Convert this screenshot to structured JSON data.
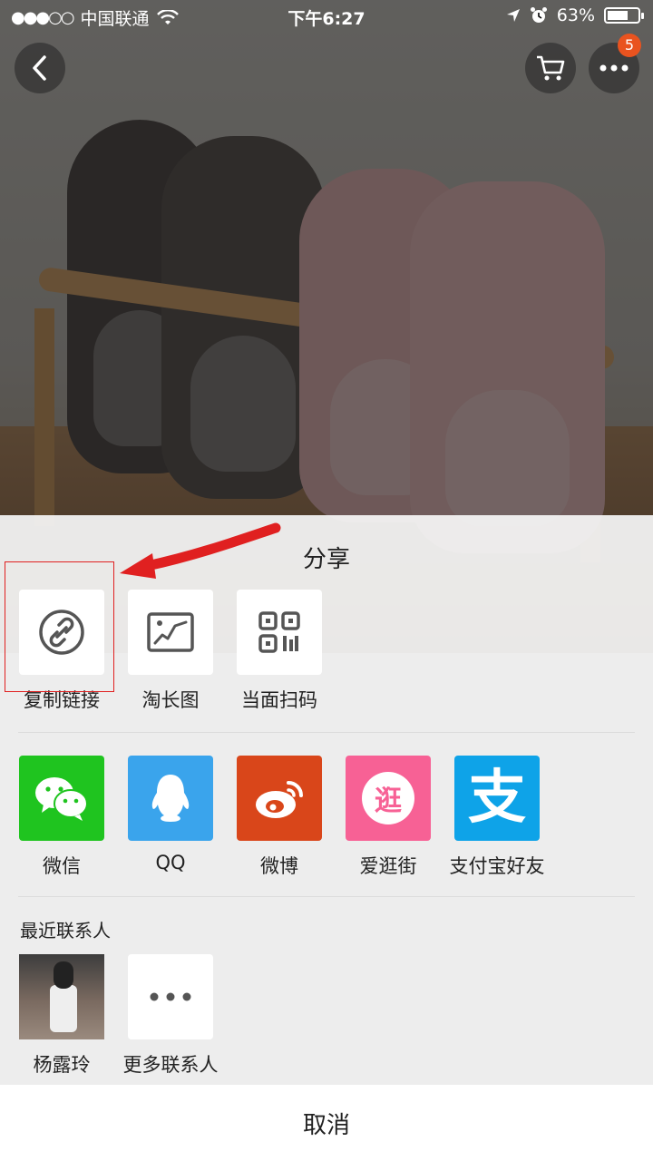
{
  "status_bar": {
    "signal": "●●●○○",
    "carrier": "中国联通",
    "time": "下午6:27",
    "battery": "63%"
  },
  "nav": {
    "back_icon": "chevron-left-icon",
    "cart_icon": "cart-icon",
    "more_icon": "more-icon",
    "more_badge": "5"
  },
  "share_sheet": {
    "title": "分享",
    "row1": [
      {
        "label": "复制链接",
        "icon": "link-icon"
      },
      {
        "label": "淘长图",
        "icon": "long-image-icon"
      },
      {
        "label": "当面扫码",
        "icon": "qr-code-icon"
      }
    ],
    "row2": [
      {
        "label": "微信",
        "icon": "wechat-icon",
        "color": "#1fc41f"
      },
      {
        "label": "QQ",
        "icon": "qq-icon",
        "color": "#3aa4ec"
      },
      {
        "label": "微博",
        "icon": "weibo-icon",
        "color": "#d9461a"
      },
      {
        "label": "爱逛街",
        "icon": "aiguangjie-icon",
        "color": "#f76195",
        "glyph": "逛"
      },
      {
        "label": "支付宝好友",
        "icon": "alipay-icon",
        "color": "#0ea3e8",
        "glyph": "支"
      }
    ],
    "recent_title": "最近联系人",
    "contacts": [
      {
        "label": "杨露玲",
        "icon": "contact-avatar"
      },
      {
        "label": "更多联系人",
        "icon": "more-contacts-icon"
      }
    ],
    "cancel": "取消"
  },
  "highlight_color": "#e02020"
}
